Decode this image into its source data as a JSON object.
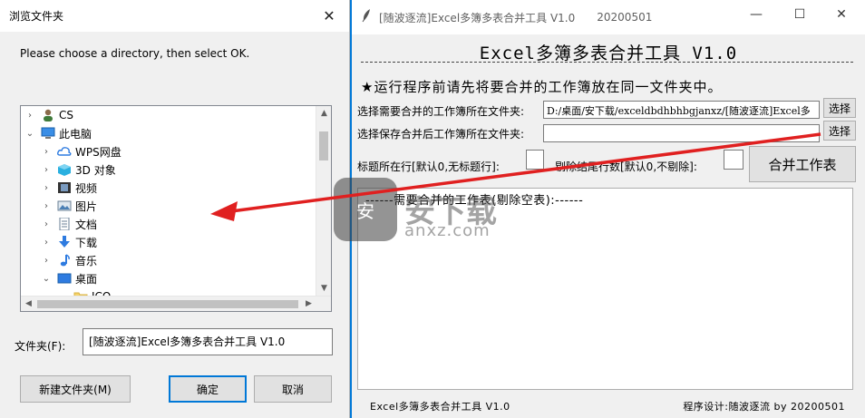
{
  "browse_dialog": {
    "title": "浏览文件夹",
    "close_glyph": "✕",
    "prompt": "Please choose a directory, then select OK.",
    "tree": [
      {
        "label": "CS",
        "icon": "user-icon",
        "chevron": "›",
        "level": 0
      },
      {
        "label": "此电脑",
        "icon": "computer-icon",
        "chevron": "⌄",
        "level": 0
      },
      {
        "label": "WPS网盘",
        "icon": "cloud-icon",
        "chevron": "›",
        "level": 1
      },
      {
        "label": "3D 对象",
        "icon": "cube-icon",
        "chevron": "›",
        "level": 1
      },
      {
        "label": "视频",
        "icon": "video-icon",
        "chevron": "›",
        "level": 1
      },
      {
        "label": "图片",
        "icon": "picture-icon",
        "chevron": "›",
        "level": 1
      },
      {
        "label": "文档",
        "icon": "document-icon",
        "chevron": "›",
        "level": 1
      },
      {
        "label": "下载",
        "icon": "download-icon",
        "chevron": "›",
        "level": 1
      },
      {
        "label": "音乐",
        "icon": "music-icon",
        "chevron": "›",
        "level": 1
      },
      {
        "label": "桌面",
        "icon": "desktop-icon",
        "chevron": "⌄",
        "level": 1
      },
      {
        "label": "ICO",
        "icon": "folder-icon",
        "chevron": "",
        "level": 2
      }
    ],
    "folder_label": "文件夹(F):",
    "folder_value": "[随波逐流]Excel多簿多表合并工具 V1.0",
    "new_folder_button": "新建文件夹(M)",
    "ok_button": "确定",
    "cancel_button": "取消"
  },
  "tool_window": {
    "title": "[随波逐流]Excel多簿多表合并工具 V1.0",
    "title_date": "20200501",
    "minimize_glyph": "—",
    "maximize_glyph": "☐",
    "close_glyph": "✕",
    "heading": "Excel多簿多表合并工具 V1.0",
    "notice": "★运行程序前请先将要合并的工作簿放在同一文件夹中。",
    "source_label": "选择需要合并的工作簿所在文件夹:",
    "source_value": "D:/桌面/安下载/exceldbdhbhbgjanxz/[随波逐流]Excel多",
    "source_button": "选择",
    "save_label": "选择保存合并后工作簿所在文件夹:",
    "save_value": "",
    "save_button": "选择",
    "header_row_label": "标题所在行[默认0,无标题行]:",
    "header_row_value": "",
    "trailing_rows_label": "剔除结尾行数[默认0,不剔除]:",
    "trailing_rows_value": "",
    "merge_button": "合并工作表",
    "output_line": "------需要合并的工作表(剔除空表):------",
    "footer_left": "Excel多簿多表合并工具 V1.0",
    "footer_right": "程序设计:随波逐流 by 20200501"
  },
  "watermark": {
    "logo": "安",
    "text": "安下载",
    "url": "anxz.com"
  },
  "colors": {
    "desktop": "#0078d7",
    "arrow": "#e02020",
    "selection_border": "#0078d7"
  }
}
